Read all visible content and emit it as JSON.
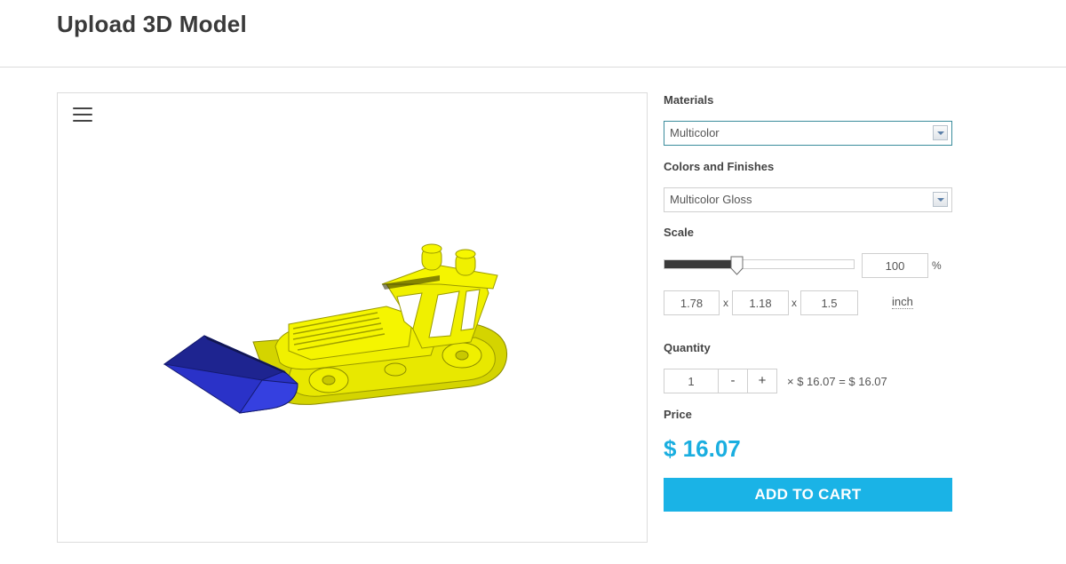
{
  "header": {
    "title": "Upload 3D Model"
  },
  "viewer": {
    "menu_icon": "hamburger-menu-icon",
    "model": "bulldozer-3d-model"
  },
  "materials": {
    "label": "Materials",
    "selected": "Multicolor"
  },
  "finishes": {
    "label": "Colors and Finishes",
    "selected": "Multicolor Gloss"
  },
  "scale": {
    "label": "Scale",
    "slider_fraction": 0.38,
    "percent": "100",
    "percent_unit": "%",
    "dimensions": [
      "1.78",
      "1.18",
      "1.5"
    ],
    "separator": "x",
    "unit": "inch"
  },
  "quantity": {
    "label": "Quantity",
    "value": "1",
    "decrement": "-",
    "increment": "+",
    "formula": "× $ 16.07 = $ 16.07"
  },
  "price": {
    "label": "Price",
    "value": "$ 16.07"
  },
  "cart": {
    "button_label": "ADD TO CART"
  },
  "colors": {
    "accent": "#1ab3e6",
    "model_body": "#f0f000",
    "model_bucket": "#2a32c8"
  }
}
